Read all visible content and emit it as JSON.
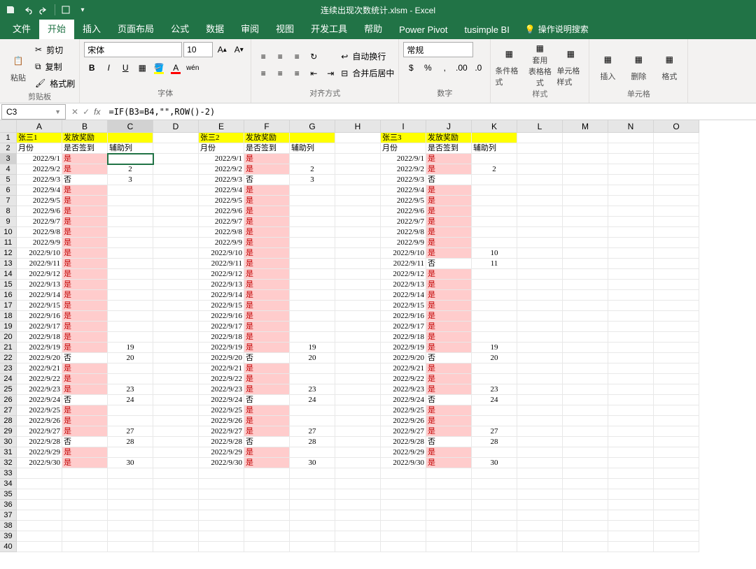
{
  "title": "连续出现次数统计.xlsm - Excel",
  "tabs": [
    "文件",
    "开始",
    "插入",
    "页面布局",
    "公式",
    "数据",
    "审阅",
    "视图",
    "开发工具",
    "帮助",
    "Power Pivot",
    "tusimple BI"
  ],
  "tellme": "操作说明搜索",
  "ribbon": {
    "clipboard": {
      "paste": "粘贴",
      "cut": "剪切",
      "copy": "复制",
      "painter": "格式刷",
      "label": "剪贴板"
    },
    "font": {
      "family": "宋体",
      "size": "10",
      "label": "字体"
    },
    "align": {
      "wrap": "自动换行",
      "merge": "合并后居中",
      "label": "对齐方式"
    },
    "number": {
      "format": "常规",
      "label": "数字"
    },
    "styles": {
      "cond": "条件格式",
      "table": "套用\n表格格式",
      "cell": "单元格样式",
      "label": "样式"
    },
    "cells": {
      "insert": "插入",
      "delete": "删除",
      "format": "格式",
      "label": "单元格"
    }
  },
  "namebox": "C3",
  "formula": "=IF(B3=B4,\"\",ROW()-2)",
  "headers": {
    "name1": "张三1",
    "name2": "张三2",
    "name3": "张三3",
    "reward": "发放奖励",
    "month": "月份",
    "sign": "是否签到",
    "helper": "辅助列"
  },
  "yes": "是",
  "no": "否",
  "data": [
    {
      "d": "2022/9/1",
      "s1": "是",
      "c1": "",
      "s2": "是",
      "c2": "",
      "s3": "是",
      "c3": ""
    },
    {
      "d": "2022/9/2",
      "s1": "是",
      "c1": "2",
      "s2": "是",
      "c2": "2",
      "s3": "是",
      "c3": "2"
    },
    {
      "d": "2022/9/3",
      "s1": "否",
      "c1": "3",
      "s2": "否",
      "c2": "3",
      "s3": "否",
      "c3": ""
    },
    {
      "d": "2022/9/4",
      "s1": "是",
      "c1": "",
      "s2": "是",
      "c2": "",
      "s3": "是",
      "c3": ""
    },
    {
      "d": "2022/9/5",
      "s1": "是",
      "c1": "",
      "s2": "是",
      "c2": "",
      "s3": "是",
      "c3": ""
    },
    {
      "d": "2022/9/6",
      "s1": "是",
      "c1": "",
      "s2": "是",
      "c2": "",
      "s3": "是",
      "c3": ""
    },
    {
      "d": "2022/9/7",
      "s1": "是",
      "c1": "",
      "s2": "是",
      "c2": "",
      "s3": "是",
      "c3": ""
    },
    {
      "d": "2022/9/8",
      "s1": "是",
      "c1": "",
      "s2": "是",
      "c2": "",
      "s3": "是",
      "c3": ""
    },
    {
      "d": "2022/9/9",
      "s1": "是",
      "c1": "",
      "s2": "是",
      "c2": "",
      "s3": "是",
      "c3": ""
    },
    {
      "d": "2022/9/10",
      "s1": "是",
      "c1": "",
      "s2": "是",
      "c2": "",
      "s3": "是",
      "c3": "10"
    },
    {
      "d": "2022/9/11",
      "s1": "是",
      "c1": "",
      "s2": "是",
      "c2": "",
      "s3": "否",
      "c3": "11"
    },
    {
      "d": "2022/9/12",
      "s1": "是",
      "c1": "",
      "s2": "是",
      "c2": "",
      "s3": "是",
      "c3": ""
    },
    {
      "d": "2022/9/13",
      "s1": "是",
      "c1": "",
      "s2": "是",
      "c2": "",
      "s3": "是",
      "c3": ""
    },
    {
      "d": "2022/9/14",
      "s1": "是",
      "c1": "",
      "s2": "是",
      "c2": "",
      "s3": "是",
      "c3": ""
    },
    {
      "d": "2022/9/15",
      "s1": "是",
      "c1": "",
      "s2": "是",
      "c2": "",
      "s3": "是",
      "c3": ""
    },
    {
      "d": "2022/9/16",
      "s1": "是",
      "c1": "",
      "s2": "是",
      "c2": "",
      "s3": "是",
      "c3": ""
    },
    {
      "d": "2022/9/17",
      "s1": "是",
      "c1": "",
      "s2": "是",
      "c2": "",
      "s3": "是",
      "c3": ""
    },
    {
      "d": "2022/9/18",
      "s1": "是",
      "c1": "",
      "s2": "是",
      "c2": "",
      "s3": "是",
      "c3": ""
    },
    {
      "d": "2022/9/19",
      "s1": "是",
      "c1": "19",
      "s2": "是",
      "c2": "19",
      "s3": "是",
      "c3": "19"
    },
    {
      "d": "2022/9/20",
      "s1": "否",
      "c1": "20",
      "s2": "否",
      "c2": "20",
      "s3": "否",
      "c3": "20"
    },
    {
      "d": "2022/9/21",
      "s1": "是",
      "c1": "",
      "s2": "是",
      "c2": "",
      "s3": "是",
      "c3": ""
    },
    {
      "d": "2022/9/22",
      "s1": "是",
      "c1": "",
      "s2": "是",
      "c2": "",
      "s3": "是",
      "c3": ""
    },
    {
      "d": "2022/9/23",
      "s1": "是",
      "c1": "23",
      "s2": "是",
      "c2": "23",
      "s3": "是",
      "c3": "23"
    },
    {
      "d": "2022/9/24",
      "s1": "否",
      "c1": "24",
      "s2": "否",
      "c2": "24",
      "s3": "否",
      "c3": "24"
    },
    {
      "d": "2022/9/25",
      "s1": "是",
      "c1": "",
      "s2": "是",
      "c2": "",
      "s3": "是",
      "c3": ""
    },
    {
      "d": "2022/9/26",
      "s1": "是",
      "c1": "",
      "s2": "是",
      "c2": "",
      "s3": "是",
      "c3": ""
    },
    {
      "d": "2022/9/27",
      "s1": "是",
      "c1": "27",
      "s2": "是",
      "c2": "27",
      "s3": "是",
      "c3": "27"
    },
    {
      "d": "2022/9/28",
      "s1": "否",
      "c1": "28",
      "s2": "否",
      "c2": "28",
      "s3": "否",
      "c3": "28"
    },
    {
      "d": "2022/9/29",
      "s1": "是",
      "c1": "",
      "s2": "是",
      "c2": "",
      "s3": "是",
      "c3": ""
    },
    {
      "d": "2022/9/30",
      "s1": "是",
      "c1": "30",
      "s2": "是",
      "c2": "30",
      "s3": "是",
      "c3": "30"
    }
  ]
}
